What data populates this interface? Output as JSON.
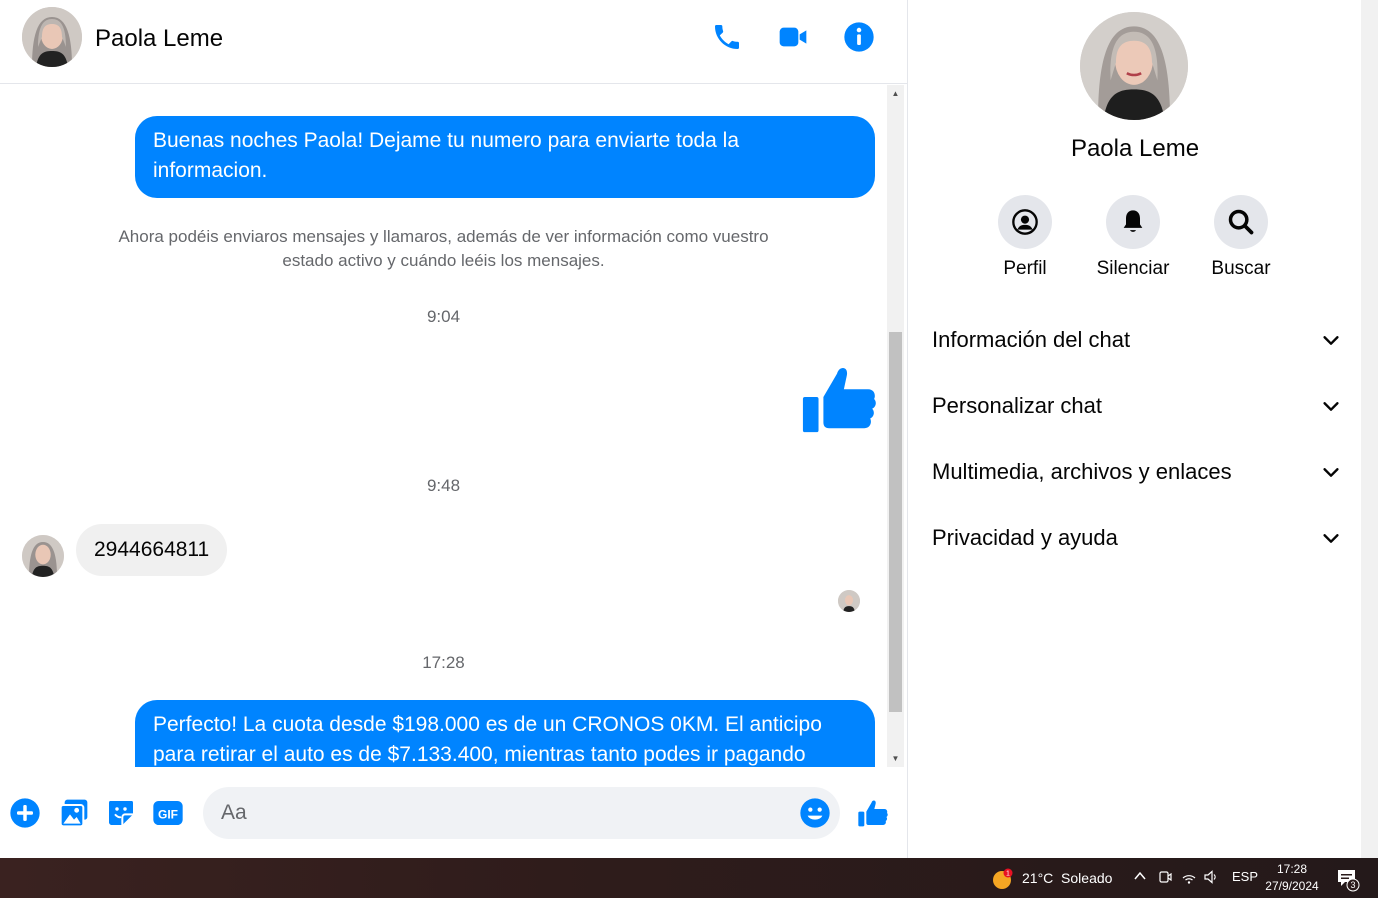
{
  "contact": {
    "name": "Paola Leme"
  },
  "messages": {
    "outgoing_1": "Buenas noches Paola! Dejame tu numero para enviarte toda la informacion.",
    "system_note": "Ahora podéis enviaros mensajes y llamaros, además de ver información como vuestro estado activo y cuándo leéis los mensajes.",
    "time_1": "9:04",
    "time_2": "9:48",
    "incoming_1": "2944664811",
    "time_3": "17:28",
    "outgoing_2": "Perfecto! La cuota desde $198.000 es de un CRONOS 0KM. El anticipo para retirar el auto es de $7.133.400, mientras tanto podes ir pagando"
  },
  "composer": {
    "placeholder": "Aa"
  },
  "panel": {
    "actions": [
      {
        "label": "Perfil",
        "icon": "profile-icon"
      },
      {
        "label": "Silenciar",
        "icon": "bell-icon"
      },
      {
        "label": "Buscar",
        "icon": "search-icon"
      }
    ],
    "sections": [
      "Información del chat",
      "Personalizar chat",
      "Multimedia, archivos y enlaces",
      "Privacidad y ayuda"
    ]
  },
  "taskbar": {
    "weather": "21°C  Soleado",
    "weather_badge": "1",
    "language": "ESP",
    "time": "17:28",
    "date": "27/9/2024",
    "notifications": "3"
  },
  "colors": {
    "accent": "#0084ff",
    "incoming_bubble": "#f0f0f0",
    "panel_circle": "#e4e6eb"
  }
}
